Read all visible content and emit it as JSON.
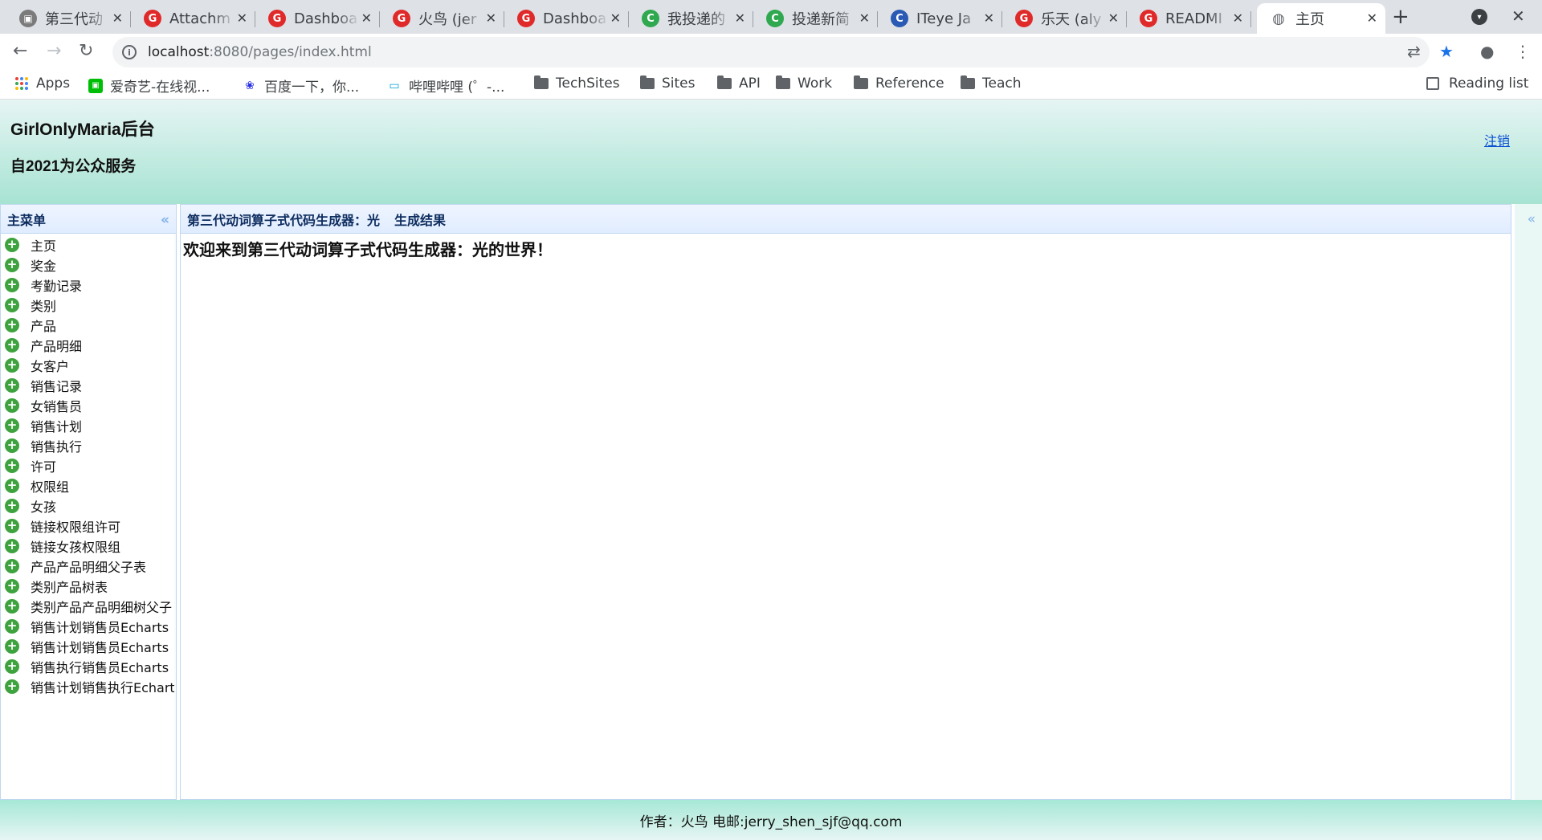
{
  "browser": {
    "tabs": [
      {
        "title": "第三代动",
        "icon": "image-favicon-icon"
      },
      {
        "title": "Attachm",
        "icon": "gitee-favicon-icon"
      },
      {
        "title": "Dashboa",
        "icon": "gitee-favicon-icon"
      },
      {
        "title": "火鸟 (jer",
        "icon": "gitee-favicon-icon"
      },
      {
        "title": "Dashboa",
        "icon": "gitee-favicon-icon"
      },
      {
        "title": "我投递的",
        "icon": "green-c-favicon-icon"
      },
      {
        "title": "投递新简",
        "icon": "green-c-favicon-icon"
      },
      {
        "title": "ITeye Ja",
        "icon": "iteye-favicon-icon"
      },
      {
        "title": "乐天 (aly",
        "icon": "gitee-favicon-icon"
      },
      {
        "title": "READMI",
        "icon": "gitee-favicon-icon"
      },
      {
        "title": "主页",
        "icon": "globe-icon",
        "active": true
      }
    ],
    "address": {
      "host": "localhost",
      "rest": ":8080/pages/index.html"
    },
    "bookmarks": [
      {
        "label": "Apps",
        "icon": "apps-grid-icon"
      },
      {
        "label": "爱奇艺-在线视...",
        "icon": "iqiyi-icon"
      },
      {
        "label": "百度一下，你...",
        "icon": "baidu-paw-icon"
      },
      {
        "label": "哔哩哔哩 (゜-...",
        "icon": "bilibili-tv-icon"
      },
      {
        "label": "TechSites",
        "icon": "folder-icon"
      },
      {
        "label": "Sites",
        "icon": "folder-icon"
      },
      {
        "label": "API",
        "icon": "folder-icon"
      },
      {
        "label": "Work",
        "icon": "folder-icon"
      },
      {
        "label": "Reference",
        "icon": "folder-icon"
      },
      {
        "label": "Teach",
        "icon": "folder-icon"
      }
    ],
    "reading_list": "Reading list"
  },
  "header": {
    "title": "GirlOnlyMaria后台",
    "subtitle": "自2021为公众服务",
    "logout": "注销"
  },
  "sidebar": {
    "title": "主菜单",
    "items": [
      "主页",
      "奖金",
      "考勤记录",
      "类别",
      "产品",
      "产品明细",
      "女客户",
      "销售记录",
      "女销售员",
      "销售计划",
      "销售执行",
      "许可",
      "权限组",
      "女孩",
      "链接权限组许可",
      "链接女孩权限组",
      "产品产品明细父子表",
      "类别产品树表",
      "类别产品产品明细树父子",
      "销售计划销售员Echarts",
      "销售计划销售员Echarts",
      "销售执行销售员Echarts",
      "销售计划销售执行Echarts"
    ]
  },
  "main": {
    "header_left": "第三代动词算子式代码生成器：光",
    "header_right": "生成结果",
    "welcome": "欢迎来到第三代动词算子式代码生成器：光的世界！"
  },
  "footer": {
    "text": "作者：火鸟 电邮:jerry_shen_sjf@qq.com"
  },
  "colors": {
    "header_gradient_top": "#e6f5f3",
    "header_gradient_bottom": "#a7e3d2",
    "panel_header": "#e0ecff",
    "plus_icon": "#3ea33e",
    "link": "#0b4fd3"
  }
}
